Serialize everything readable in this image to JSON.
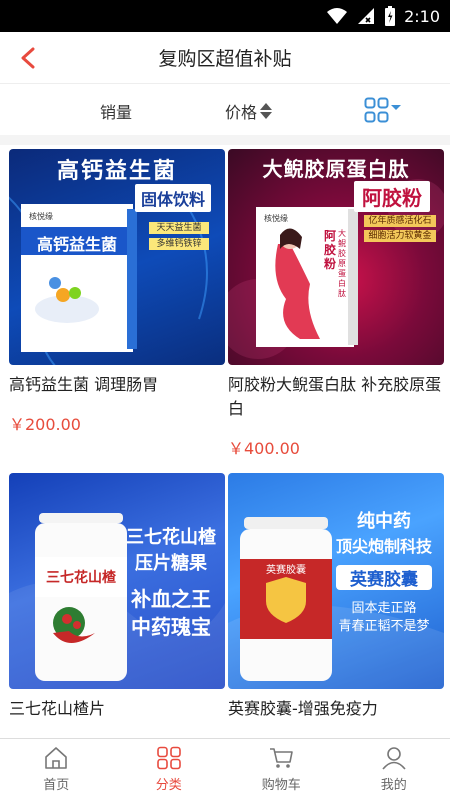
{
  "status": {
    "time": "2:10"
  },
  "nav": {
    "title": "复购区超值补贴"
  },
  "sort": {
    "sales_label": "销量",
    "price_label": "价格"
  },
  "products": [
    {
      "title": "高钙益生菌 调理肠胃",
      "price": "￥200.00",
      "poster": {
        "headline": "高钙益生菌",
        "subhead": "固体饮料",
        "tag1": "天天益生菌",
        "tag2": "多维钙铁锌",
        "box_label": "高钙益生菌",
        "brand": "核悦缘"
      }
    },
    {
      "title": "阿胶粉大鲵蛋白肽 补充胶原蛋白",
      "price": "￥400.00",
      "poster": {
        "headline": "大鲵胶原蛋白肽",
        "subhead": "阿胶粉",
        "tag1": "亿年质感活化石",
        "tag2": "细胞活力软黄金",
        "box_label": "阿胶粉",
        "box_sub": "大鲵胶原蛋白肽",
        "brand": "核悦缘"
      }
    },
    {
      "title": "三七花山楂片",
      "price": "",
      "poster": {
        "headline": "三七花山楂",
        "subhead": "压片糖果",
        "line1": "补血之王",
        "line2": "中药瑰宝",
        "bottle_label": "三七花山楂"
      }
    },
    {
      "title": "英赛胶囊-增强免疫力",
      "price": "",
      "poster": {
        "headline": "纯中药",
        "subhead": "顶尖炮制科技",
        "name": "英赛胶囊",
        "line1": "固本走正路",
        "line2": "青春正韬不是梦",
        "bottle_label": "英赛胶囊"
      }
    }
  ],
  "tabs": [
    {
      "label": "首页",
      "icon": "home-icon",
      "active": false
    },
    {
      "label": "分类",
      "icon": "category-icon",
      "active": true
    },
    {
      "label": "购物车",
      "icon": "cart-icon",
      "active": false
    },
    {
      "label": "我的",
      "icon": "user-icon",
      "active": false
    }
  ],
  "colors": {
    "accent": "#e84a3e",
    "price": "#e74c3c",
    "grid_icon": "#3b8fd6"
  }
}
